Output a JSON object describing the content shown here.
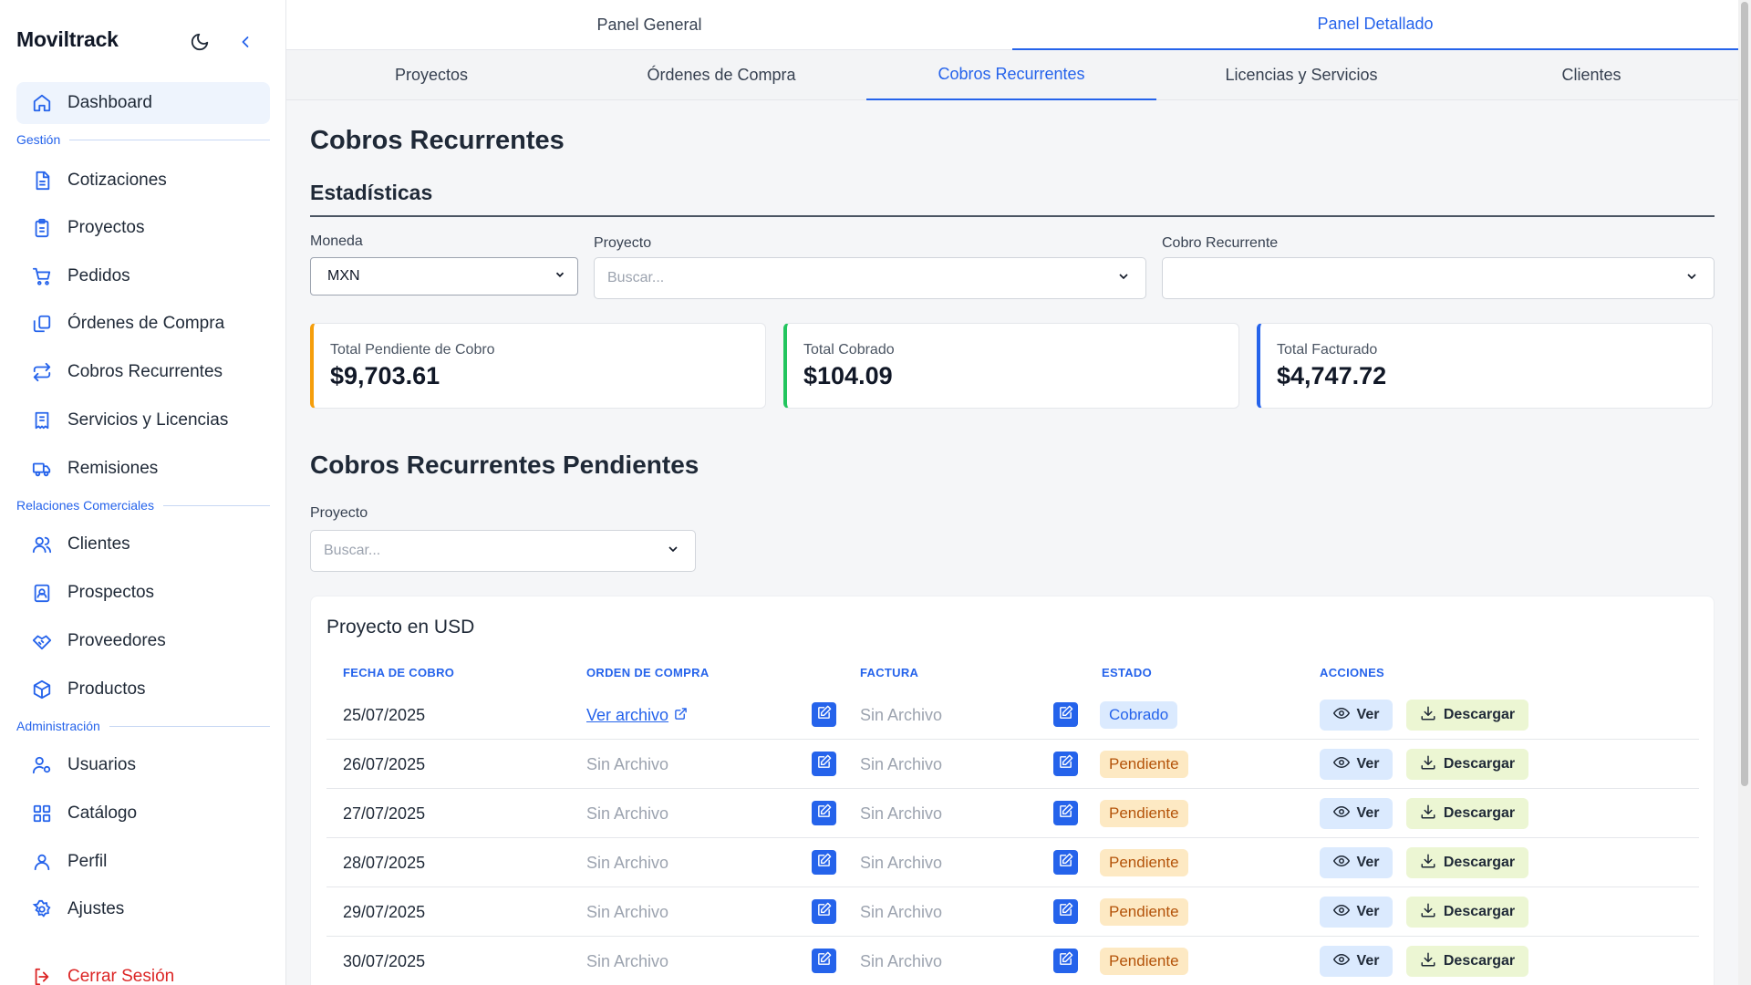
{
  "app": {
    "brand": "Moviltrack"
  },
  "sidebar": {
    "dashboard": "Dashboard",
    "sections": {
      "gestion": "Gestión",
      "relaciones": "Relaciones Comerciales",
      "administracion": "Administración"
    },
    "items": [
      {
        "label": "Cotizaciones",
        "icon": "file-text-icon"
      },
      {
        "label": "Proyectos",
        "icon": "clipboard-icon"
      },
      {
        "label": "Pedidos",
        "icon": "cart-icon"
      },
      {
        "label": "Órdenes de Compra",
        "icon": "copy-icon"
      },
      {
        "label": "Cobros Recurrentes",
        "icon": "repeat-icon"
      },
      {
        "label": "Servicios y Licencias",
        "icon": "receipt-icon"
      },
      {
        "label": "Remisiones",
        "icon": "truck-icon"
      },
      {
        "label": "Clientes",
        "icon": "users-icon"
      },
      {
        "label": "Prospectos",
        "icon": "contact-icon"
      },
      {
        "label": "Proveedores",
        "icon": "handshake-icon"
      },
      {
        "label": "Productos",
        "icon": "box-icon"
      },
      {
        "label": "Usuarios",
        "icon": "user-cog-icon"
      },
      {
        "label": "Catálogo",
        "icon": "grid-icon"
      },
      {
        "label": "Perfil",
        "icon": "user-icon"
      },
      {
        "label": "Ajustes",
        "icon": "gear-icon"
      }
    ],
    "logout": "Cerrar Sesión"
  },
  "top_tabs": [
    "Panel General",
    "Panel Detallado"
  ],
  "sub_tabs": [
    "Proyectos",
    "Órdenes de Compra",
    "Cobros Recurrentes",
    "Licencias y Servicios",
    "Clientes"
  ],
  "page": {
    "title": "Cobros Recurrentes",
    "stats_title": "Estadísticas",
    "filters": {
      "moneda_label": "Moneda",
      "moneda_value": "MXN",
      "proyecto_label": "Proyecto",
      "proyecto_placeholder": "Buscar...",
      "cobro_label": "Cobro Recurrente",
      "cobro_value": ""
    },
    "cards": [
      {
        "title": "Total Pendiente de Cobro",
        "value": "$9,703.61",
        "accent": "#f59e0b"
      },
      {
        "title": "Total Cobrado",
        "value": "$104.09",
        "accent": "#22c55e"
      },
      {
        "title": "Total Facturado",
        "value": "$4,747.72",
        "accent": "#2563eb"
      }
    ],
    "pending_title": "Cobros Recurrentes Pendientes",
    "pending_filter": {
      "label": "Proyecto",
      "placeholder": "Buscar..."
    }
  },
  "table": {
    "title": "Proyecto en USD",
    "headers": {
      "fecha": "FECHA DE COBRO",
      "orden": "ORDEN DE COMPRA",
      "factura": "FACTURA",
      "estado": "ESTADO",
      "acciones": "ACCIONES"
    },
    "view_label": "Ver",
    "download_label": "Descargar",
    "rows": [
      {
        "fecha": "25/07/2025",
        "orden": "Ver archivo",
        "orden_link": true,
        "factura": "Sin Archivo",
        "estado": "Cobrado"
      },
      {
        "fecha": "26/07/2025",
        "orden": "Sin Archivo",
        "orden_link": false,
        "factura": "Sin Archivo",
        "estado": "Pendiente"
      },
      {
        "fecha": "27/07/2025",
        "orden": "Sin Archivo",
        "orden_link": false,
        "factura": "Sin Archivo",
        "estado": "Pendiente"
      },
      {
        "fecha": "28/07/2025",
        "orden": "Sin Archivo",
        "orden_link": false,
        "factura": "Sin Archivo",
        "estado": "Pendiente"
      },
      {
        "fecha": "29/07/2025",
        "orden": "Sin Archivo",
        "orden_link": false,
        "factura": "Sin Archivo",
        "estado": "Pendiente"
      },
      {
        "fecha": "30/07/2025",
        "orden": "Sin Archivo",
        "orden_link": false,
        "factura": "Sin Archivo",
        "estado": "Pendiente"
      }
    ]
  },
  "colors": {
    "accent": "#2563eb",
    "danger": "#dc2626",
    "pending_bg": "#fde9c3",
    "paid_bg": "#dbeafe"
  }
}
